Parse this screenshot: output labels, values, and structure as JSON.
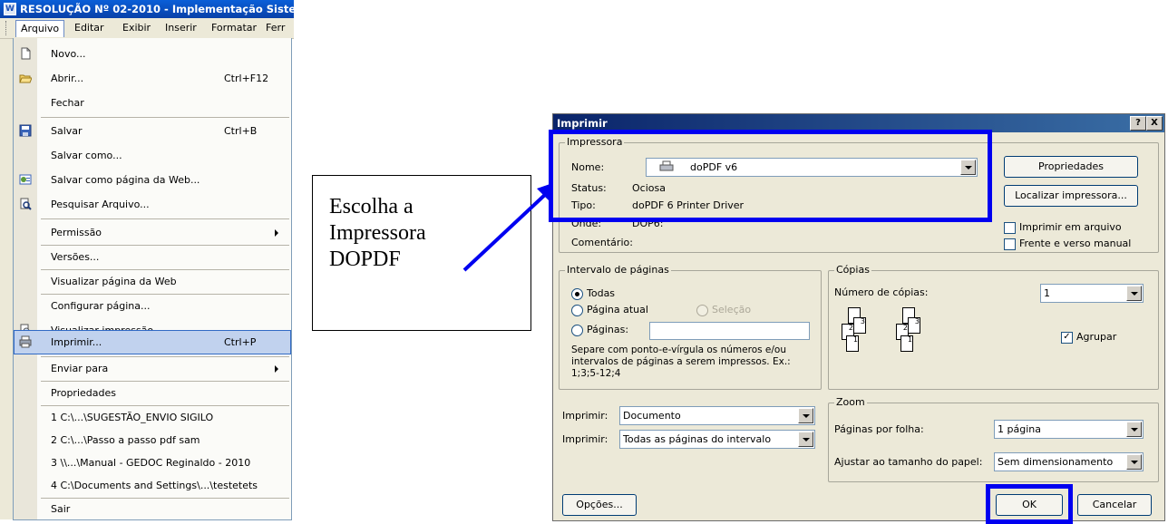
{
  "word": {
    "title": "RESOLUÇÃO Nº 02-2010 - Implementação Siste",
    "menubar": [
      {
        "label": "Arquivo"
      },
      {
        "label": "Editar"
      },
      {
        "label": "Exibir"
      },
      {
        "label": "Inserir"
      },
      {
        "label": "Formatar"
      },
      {
        "label": "Ferr"
      }
    ],
    "file_menu": [
      {
        "label": "Novo...",
        "shortcut": "",
        "icon": "new-document-icon"
      },
      {
        "label": "Abrir...",
        "shortcut": "Ctrl+F12",
        "icon": "open-folder-icon"
      },
      {
        "label": "Fechar",
        "shortcut": ""
      },
      {
        "label": "Salvar",
        "shortcut": "Ctrl+B",
        "icon": "save-disk-icon"
      },
      {
        "label": "Salvar como...",
        "shortcut": ""
      },
      {
        "label": "Salvar como página da Web...",
        "shortcut": "",
        "icon": "web-page-icon"
      },
      {
        "label": "Pesquisar Arquivo...",
        "shortcut": "",
        "icon": "search-file-icon"
      },
      {
        "label": "Permissão",
        "shortcut": ""
      },
      {
        "label": "Versões...",
        "shortcut": ""
      },
      {
        "label": "Visualizar página da Web",
        "shortcut": ""
      },
      {
        "label": "Configurar página...",
        "shortcut": ""
      },
      {
        "label": "Visualizar impressão",
        "shortcut": "",
        "icon": "print-preview-icon"
      },
      {
        "label": "Imprimir...",
        "shortcut": "Ctrl+P",
        "icon": "printer-icon"
      },
      {
        "label": "Enviar para",
        "shortcut": ""
      },
      {
        "label": "Propriedades",
        "shortcut": ""
      },
      {
        "label": "1 C:\\...\\SUGESTÃO_ENVIO SIGILO",
        "shortcut": ""
      },
      {
        "label": "2 C:\\...\\Passo a passo pdf sam",
        "shortcut": ""
      },
      {
        "label": "3 \\\\...\\Manual - GEDOC Reginaldo - 2010",
        "shortcut": ""
      },
      {
        "label": "4 C:\\Documents and Settings\\...\\testetets",
        "shortcut": ""
      },
      {
        "label": "Sair",
        "shortcut": ""
      }
    ]
  },
  "annotation": {
    "line1": "Escolha a",
    "line2": "Impressora",
    "line3": "DOPDF",
    "highlight_color": "#0000f0"
  },
  "dialog": {
    "title": "Imprimir",
    "help_btn": "?",
    "close_btn": "X",
    "printer": {
      "legend": "Impressora",
      "name_label": "Nome:",
      "name_value": "doPDF v6",
      "status_label": "Status:",
      "status_value": "Ociosa",
      "type_label": "Tipo:",
      "type_value": "doPDF  6 Printer Driver",
      "where_label": "Onde:",
      "where_value": "DOP6:",
      "comment_label": "Comentário:",
      "properties_btn": "Propriedades",
      "find_btn": "Localizar impressora...",
      "print_to_file": "Imprimir em arquivo",
      "duplex_manual": "Frente e verso manual"
    },
    "range": {
      "legend": "Intervalo de páginas",
      "all": "Todas",
      "current": "Página atual",
      "selection": "Seleção",
      "pages": "Páginas:",
      "hint1": "Separe com ponto-e-vírgula os números e/ou",
      "hint2": "intervalos de páginas a serem impressos.  Ex.:",
      "hint3": "1;3;5-12;4"
    },
    "copies": {
      "legend": "Cópias",
      "count_label": "Número de cópias:",
      "count_value": "1",
      "collate": "Agrupar"
    },
    "print_what_label": "Imprimir:",
    "print_what_value": "Documento",
    "print_range_label": "Imprimir:",
    "print_range_value": "Todas as páginas do intervalo",
    "zoom": {
      "legend": "Zoom",
      "per_sheet_label": "Páginas por folha:",
      "per_sheet_value": "1 página",
      "scale_label": "Ajustar ao tamanho do papel:",
      "scale_value": "Sem dimensionamento"
    },
    "options_btn": "Opções...",
    "ok_btn": "OK",
    "cancel_btn": "Cancelar"
  }
}
